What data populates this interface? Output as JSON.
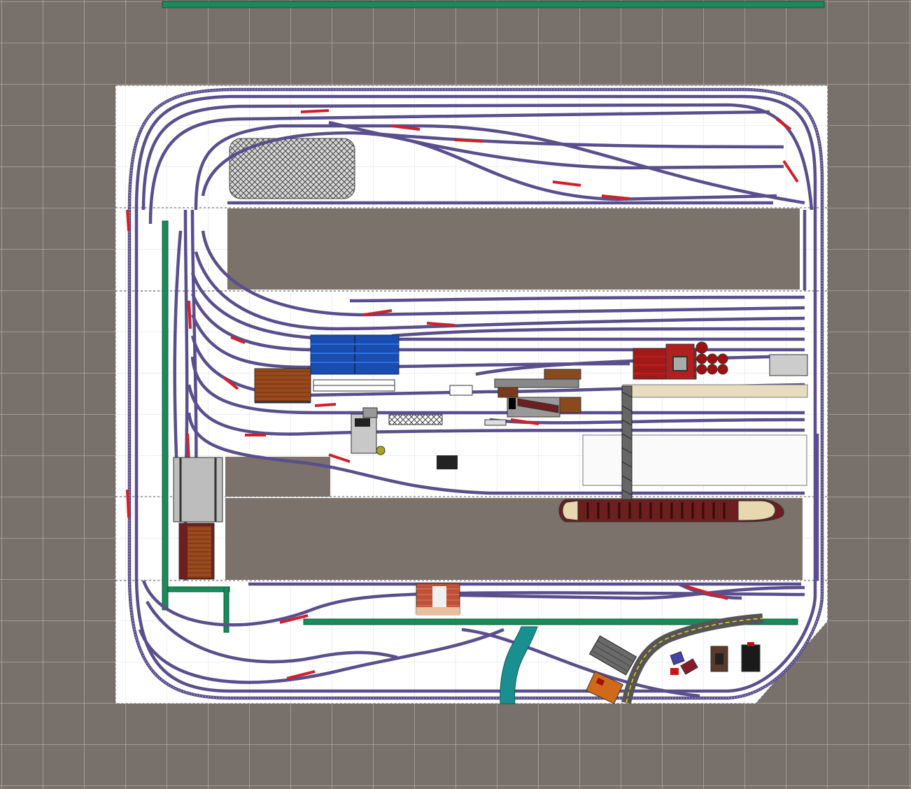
{
  "plan": {
    "colors": {
      "background": "#78706a",
      "grid_line": "#c8c4c0",
      "baseboard": "#ffffff",
      "track": "#5a4e8c",
      "turnout": "#d0202a",
      "backdrop": "#1a8a5a",
      "water": "#1a8f8f",
      "road": "#555555",
      "road_line": "#f0d020",
      "pit": "#7b726c"
    },
    "objects": [
      {
        "name": "warehouse-blue",
        "icon": "blue-roof-building"
      },
      {
        "name": "freight-shed-brown",
        "icon": "brown-roof-building"
      },
      {
        "name": "factory-red",
        "icon": "red-industrial-building"
      },
      {
        "name": "cargo-ship",
        "icon": "ship"
      },
      {
        "name": "gantry-crane",
        "icon": "crane"
      },
      {
        "name": "river",
        "icon": "water-stream"
      },
      {
        "name": "road",
        "icon": "road-with-centerline"
      },
      {
        "name": "fuel-tanks",
        "icon": "storage-tanks"
      },
      {
        "name": "station-building",
        "icon": "brick-building"
      },
      {
        "name": "engine-shed",
        "icon": "shed"
      },
      {
        "name": "small-houses",
        "icon": "houses"
      },
      {
        "name": "storage-area",
        "icon": "crosshatch-pad"
      }
    ]
  }
}
